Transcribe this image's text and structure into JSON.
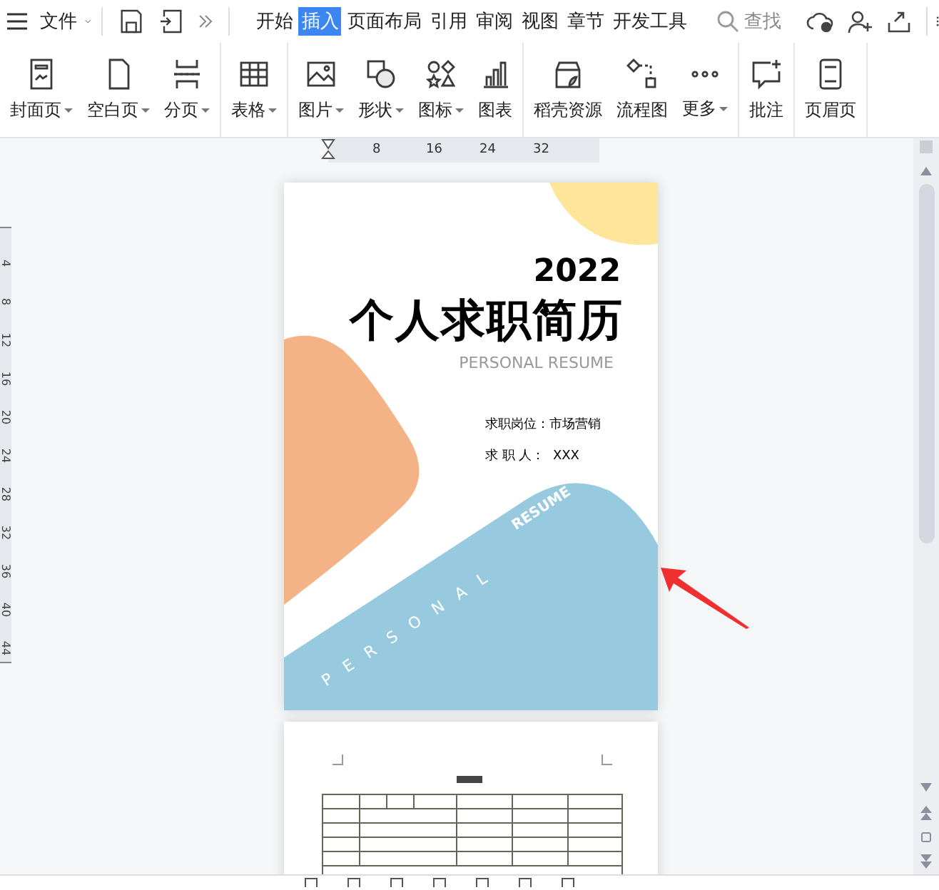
{
  "menu_bar": {
    "file_label": "文件",
    "tabs": [
      {
        "label": "开始",
        "selected": false
      },
      {
        "label": "插入",
        "selected": true
      },
      {
        "label": "页面布局",
        "selected": false
      },
      {
        "label": "引用",
        "selected": false
      },
      {
        "label": "审阅",
        "selected": false
      },
      {
        "label": "视图",
        "selected": false
      },
      {
        "label": "章节",
        "selected": false
      },
      {
        "label": "开发工具",
        "selected": false
      }
    ],
    "search": {
      "placeholder": "查找"
    }
  },
  "ribbon": {
    "groups": [
      [
        {
          "label": "封面页",
          "has_menu": true
        },
        {
          "label": "空白页",
          "has_menu": true
        },
        {
          "label": "分页",
          "has_menu": true
        }
      ],
      [
        {
          "label": "表格",
          "has_menu": true
        }
      ],
      [
        {
          "label": "图片",
          "has_menu": true
        },
        {
          "label": "形状",
          "has_menu": true
        },
        {
          "label": "图标",
          "has_menu": true
        },
        {
          "label": "图表",
          "has_menu": false
        }
      ],
      [
        {
          "label": "稻壳资源",
          "has_menu": false
        },
        {
          "label": "流程图",
          "has_menu": false
        },
        {
          "label": "更多",
          "has_menu": true
        }
      ],
      [
        {
          "label": "批注",
          "has_menu": false
        }
      ],
      [
        {
          "label": "页眉页",
          "has_menu": false
        }
      ]
    ]
  },
  "ruler": {
    "horizontal_marks": [
      "8",
      "16",
      "24",
      "32"
    ],
    "vertical_marks": [
      "4",
      "8",
      "12",
      "16",
      "20",
      "24",
      "28",
      "32",
      "36",
      "40",
      "44"
    ]
  },
  "document": {
    "cover": {
      "year": "2022",
      "title": "个人求职简历",
      "subtitle": "PERSONAL RESUME",
      "fields": [
        "求职岗位：市场营销",
        "求 职 人：  XXX"
      ],
      "band_words": [
        "PERSONAL",
        "RESUME"
      ]
    }
  }
}
